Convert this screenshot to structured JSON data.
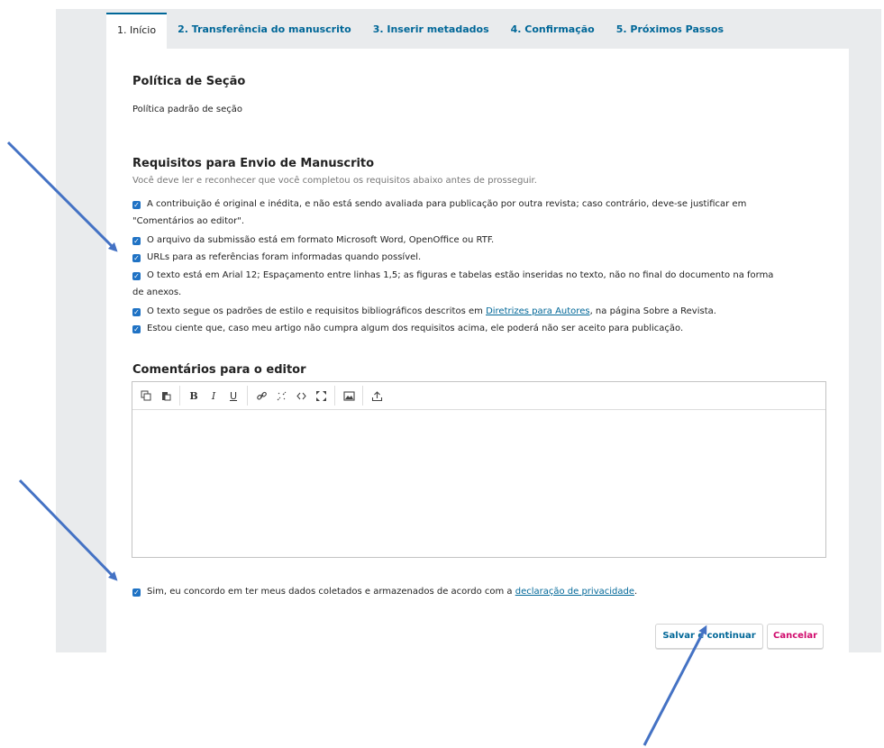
{
  "tabs": [
    {
      "label": "1. Início"
    },
    {
      "label": "2. Transferência do manuscrito"
    },
    {
      "label": "3. Inserir metadados"
    },
    {
      "label": "4. Confirmação"
    },
    {
      "label": "5. Próximos Passos"
    }
  ],
  "section_policy": {
    "heading": "Política de Seção",
    "text": "Política padrão de seção"
  },
  "requirements": {
    "heading": "Requisitos para Envio de Manuscrito",
    "description": "Você deve ler e reconhecer que você completou os requisitos abaixo antes de prosseguir.",
    "items": [
      {
        "line1": "A contribuição é original e inédita, e não está sendo avaliada para publicação por outra revista; caso contrário, deve-se justificar em",
        "line2": "\"Comentários ao editor\".",
        "checked": true
      },
      {
        "text": "O arquivo da submissão está em formato Microsoft Word, OpenOffice ou RTF.",
        "checked": true
      },
      {
        "text": "URLs para as referências foram informadas quando possível.",
        "checked": true
      },
      {
        "line1": "O texto está em Arial 12; Espaçamento entre linhas 1,5; as figuras e tabelas estão inseridas no texto, não no final do documento na forma",
        "line2": "de anexos.",
        "checked": true
      },
      {
        "before": "O texto segue os padrões de estilo e requisitos bibliográficos descritos em ",
        "link": "Diretrizes para Autores",
        "after": ", na página Sobre a Revista.",
        "checked": true
      },
      {
        "text": "Estou ciente que, caso meu artigo não cumpra algum dos requisitos acima, ele poderá não ser aceito para publicação.",
        "checked": true
      }
    ]
  },
  "comments": {
    "heading": "Comentários para o editor",
    "value": ""
  },
  "privacy": {
    "before": "Sim, eu concordo em ter meus dados coletados e armazenados de acordo com a ",
    "link": "declaração de privacidade",
    "after": ".",
    "checked": true
  },
  "buttons": {
    "save": "Salvar e continuar",
    "cancel": "Cancelar"
  },
  "check_glyph": "✓",
  "colors": {
    "accent": "#006798",
    "checkbox": "#1f72c4",
    "cancel": "#d00a6c",
    "arrow": "#4472c4"
  }
}
